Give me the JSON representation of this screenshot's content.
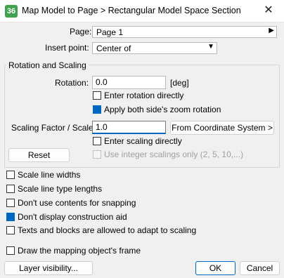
{
  "window": {
    "app_icon_text": "36",
    "title": "Map Model to Page > Rectangular Model Space Section",
    "close_glyph": "✕"
  },
  "page": {
    "label": "Page:",
    "value": "Page 1"
  },
  "insert_point": {
    "label": "Insert point:",
    "value": "Center of"
  },
  "rotation_scaling": {
    "title": "Rotation and Scaling",
    "rotation_label": "Rotation:",
    "rotation_value": "0.0",
    "rotation_unit": "[deg]",
    "enter_rotation_directly": {
      "label": "Enter rotation directly",
      "checked": false
    },
    "apply_zoom_rotation": {
      "label": "Apply both side's zoom rotation",
      "checked": true
    },
    "scaling_label": "Scaling Factor / Scale:",
    "scaling_value": "1.0",
    "from_coordinate_button": "From Coordinate System >",
    "enter_scaling_directly": {
      "label": "Enter scaling directly",
      "checked": false
    },
    "integer_scalings": {
      "label": "Use integer scalings only (2, 5, 10,...)",
      "checked": false,
      "enabled": false
    },
    "reset_button": "Reset"
  },
  "options": [
    {
      "label": "Scale line widths",
      "checked": false
    },
    {
      "label": "Scale line type lengths",
      "checked": false
    },
    {
      "label": "Don't use contents for snapping",
      "checked": false
    },
    {
      "label": "Don't display construction aid",
      "checked": true
    },
    {
      "label": "Texts and blocks are allowed to adapt to scaling",
      "checked": false
    }
  ],
  "draw_frame": {
    "label": "Draw the mapping object's frame",
    "checked": false
  },
  "footer": {
    "layer_visibility_button": "Layer visibility...",
    "ok_button": "OK",
    "cancel_button": "Cancel"
  },
  "colors": {
    "accent": "#0067c0",
    "app_icon_bg": "#3fa34d"
  }
}
